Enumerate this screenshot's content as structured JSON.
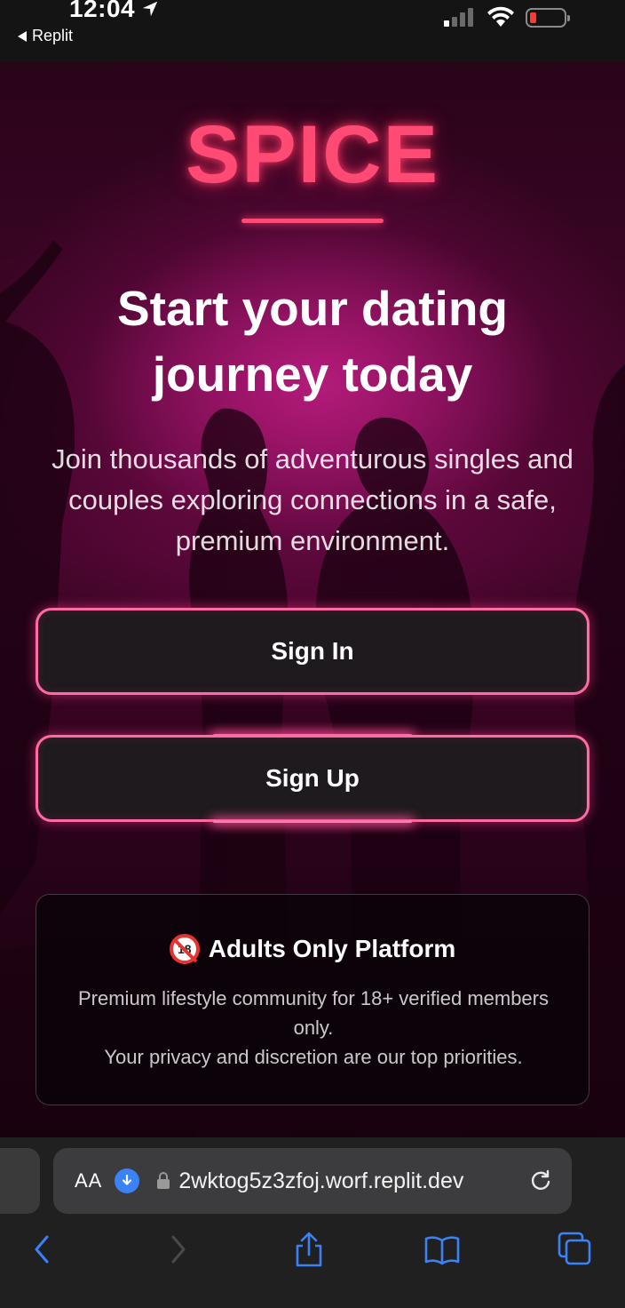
{
  "status_bar": {
    "time": "12:04",
    "back_app": "Replit",
    "battery_color": "#ff3b30"
  },
  "hero": {
    "logo": "SPICE",
    "headline": "Start your dating journey today",
    "subtext": "Join thousands of adventurous singles and couples exploring connections in a safe, premium environment.",
    "sign_in_label": "Sign In",
    "sign_up_label": "Sign Up",
    "accent_color": "#ff4b73"
  },
  "notice": {
    "icon": "no-under-18-icon",
    "badge_text": "18",
    "title": "Adults Only Platform",
    "line1": "Premium lifestyle community for 18+ verified members only.",
    "line2": "Your privacy and discretion are our top priorities."
  },
  "browser": {
    "aa_label": "AA",
    "url": "2wktog5z3zfoj.worf.replit.dev",
    "icons": [
      "back-icon",
      "forward-icon",
      "share-icon",
      "bookmarks-icon",
      "tabs-icon"
    ]
  }
}
